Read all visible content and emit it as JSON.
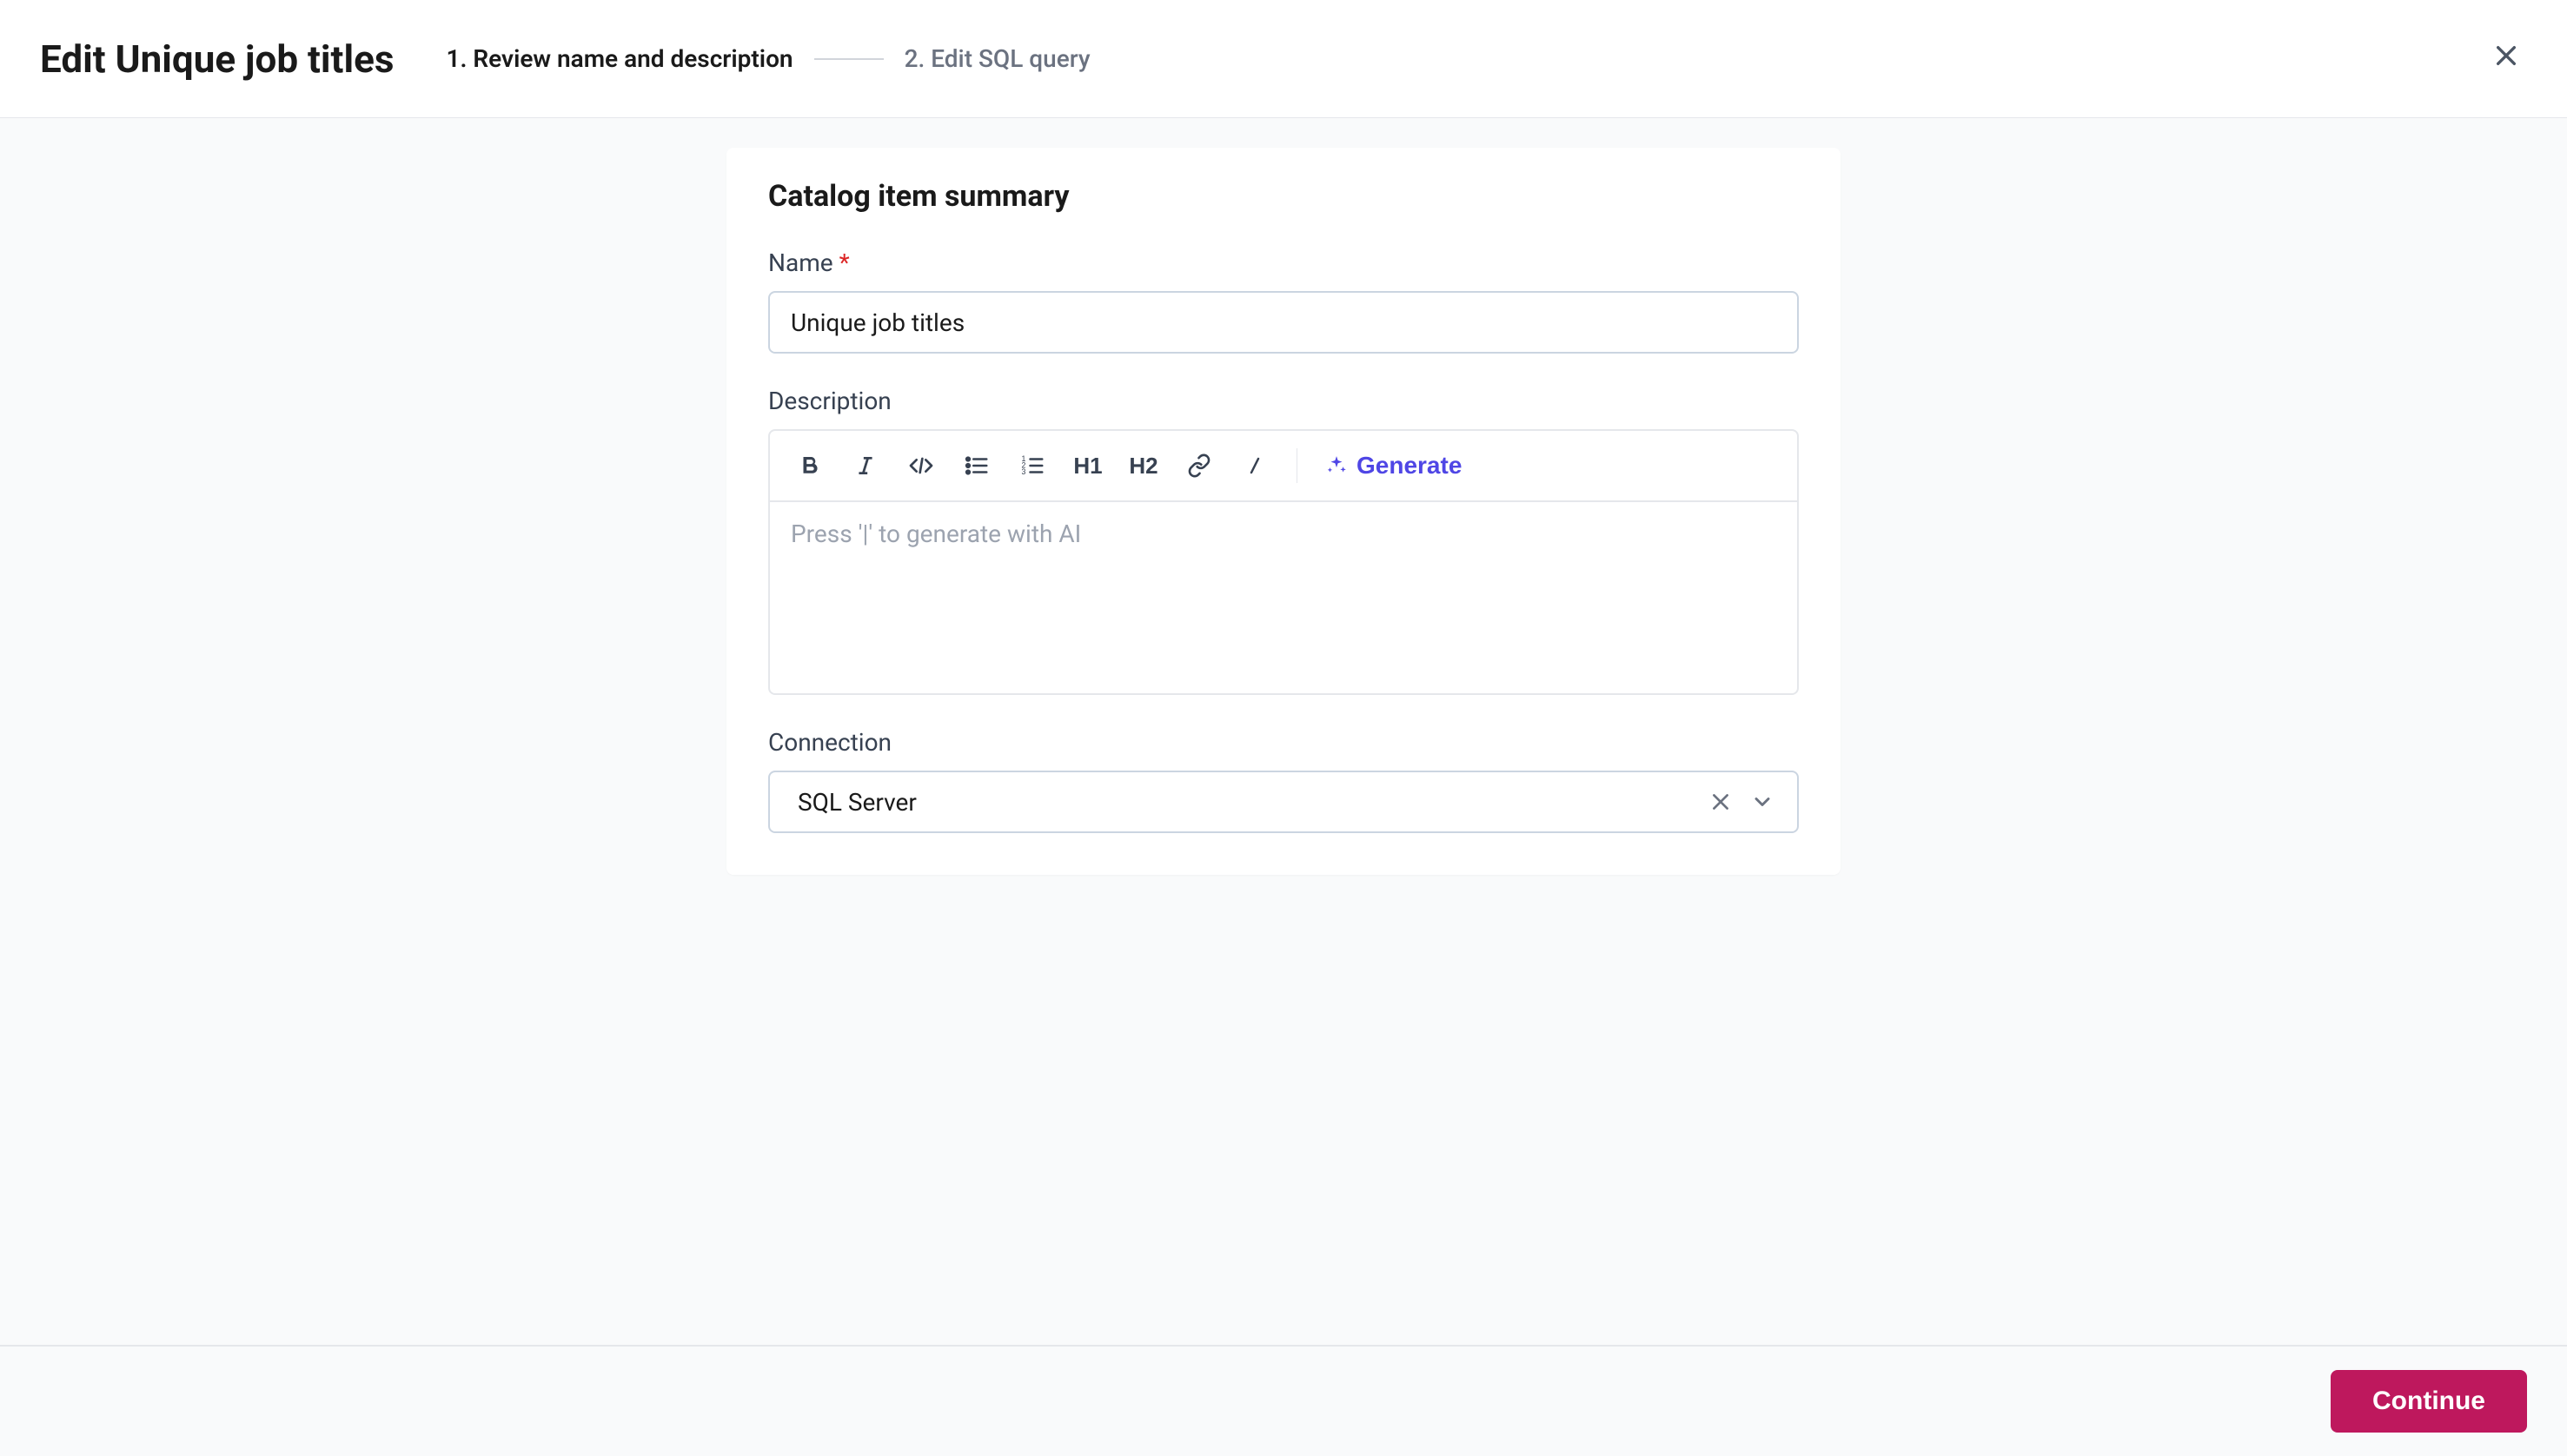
{
  "header": {
    "title": "Edit Unique job titles",
    "steps": [
      {
        "label": "1. Review name and description",
        "active": true
      },
      {
        "label": "2. Edit SQL query",
        "active": false
      }
    ]
  },
  "card": {
    "title": "Catalog item summary",
    "name": {
      "label": "Name",
      "required_mark": "*",
      "value": "Unique job titles"
    },
    "description": {
      "label": "Description",
      "placeholder": "Press '|' to generate with AI",
      "toolbar": {
        "h1": "H1",
        "h2": "H2",
        "generate": "Generate"
      }
    },
    "connection": {
      "label": "Connection",
      "value": "SQL Server"
    }
  },
  "footer": {
    "continue": "Continue"
  }
}
